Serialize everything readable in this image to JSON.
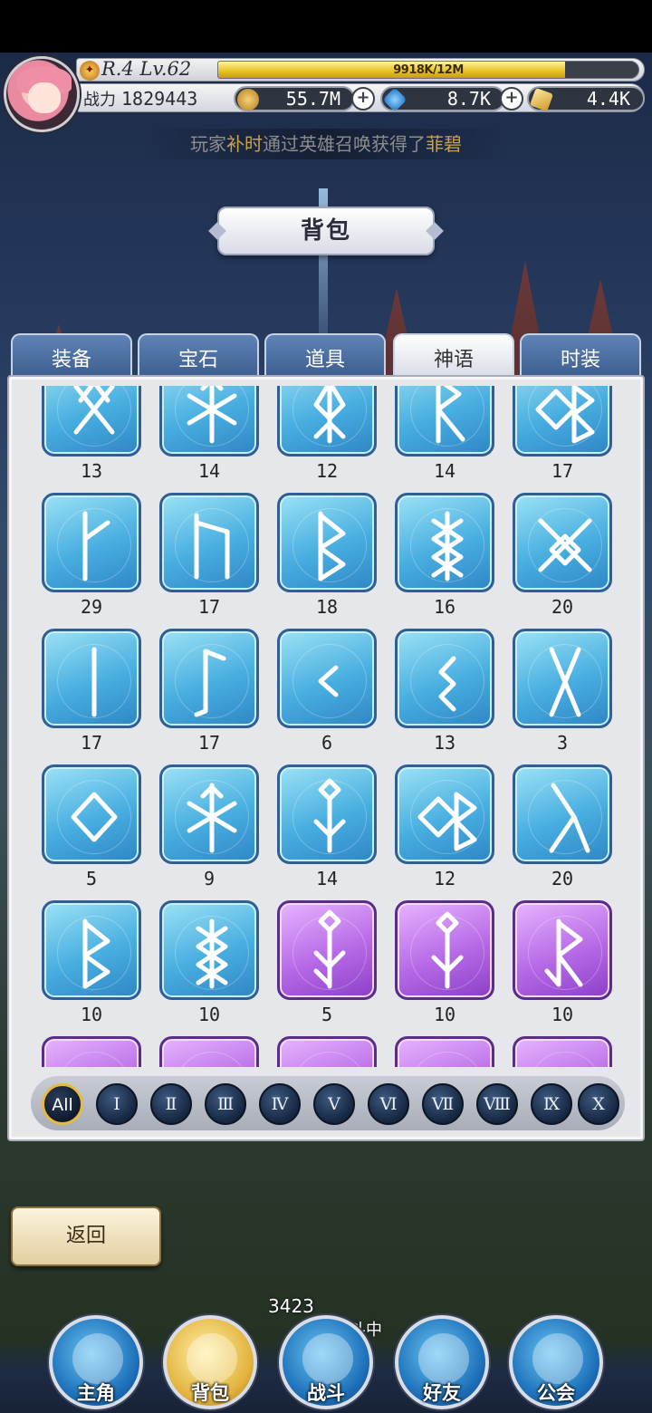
{
  "player": {
    "rank_level": "R.4 Lv.62",
    "exp_text": "9918K/12M",
    "exp_fraction": 0.8265,
    "power_label": "战力",
    "power_value": "1829443"
  },
  "currencies": [
    {
      "name": "gold",
      "icon": "coin-icon",
      "value": "55.7M",
      "color": "#d8a23a"
    },
    {
      "name": "diamond",
      "icon": "diamond-icon",
      "value": "8.7K",
      "color": "#3aa0e6"
    },
    {
      "name": "ticket",
      "icon": "ticket-icon",
      "value": "4.4K",
      "color": "#e8b548"
    }
  ],
  "ticker": {
    "prefix": "玩家",
    "player": "补时",
    "middle": "通过英雄召唤获得了",
    "item": "菲碧"
  },
  "page_title": "背包",
  "tabs": [
    {
      "label": "装备",
      "active": false
    },
    {
      "label": "宝石",
      "active": false
    },
    {
      "label": "道具",
      "active": false
    },
    {
      "label": "神语",
      "active": true
    },
    {
      "label": "时装",
      "active": false
    }
  ],
  "runes": [
    {
      "count": "13",
      "rarity": "blue"
    },
    {
      "count": "14",
      "rarity": "blue"
    },
    {
      "count": "12",
      "rarity": "blue"
    },
    {
      "count": "14",
      "rarity": "blue"
    },
    {
      "count": "17",
      "rarity": "blue"
    },
    {
      "count": "29",
      "rarity": "blue"
    },
    {
      "count": "17",
      "rarity": "blue"
    },
    {
      "count": "18",
      "rarity": "blue"
    },
    {
      "count": "16",
      "rarity": "blue"
    },
    {
      "count": "20",
      "rarity": "blue"
    },
    {
      "count": "17",
      "rarity": "blue"
    },
    {
      "count": "17",
      "rarity": "blue"
    },
    {
      "count": "6",
      "rarity": "blue"
    },
    {
      "count": "13",
      "rarity": "blue"
    },
    {
      "count": "3",
      "rarity": "blue"
    },
    {
      "count": "5",
      "rarity": "blue"
    },
    {
      "count": "9",
      "rarity": "blue"
    },
    {
      "count": "14",
      "rarity": "blue"
    },
    {
      "count": "12",
      "rarity": "blue"
    },
    {
      "count": "20",
      "rarity": "blue"
    },
    {
      "count": "10",
      "rarity": "blue"
    },
    {
      "count": "10",
      "rarity": "blue"
    },
    {
      "count": "5",
      "rarity": "purple"
    },
    {
      "count": "10",
      "rarity": "purple"
    },
    {
      "count": "10",
      "rarity": "purple"
    },
    {
      "count": "",
      "rarity": "purple"
    },
    {
      "count": "",
      "rarity": "purple"
    },
    {
      "count": "",
      "rarity": "purple"
    },
    {
      "count": "",
      "rarity": "purple"
    },
    {
      "count": "",
      "rarity": "purple"
    }
  ],
  "filters": [
    "All",
    "Ⅰ",
    "Ⅱ",
    "Ⅲ",
    "Ⅳ",
    "Ⅴ",
    "Ⅵ",
    "Ⅶ",
    "Ⅷ",
    "Ⅸ",
    "Ⅹ"
  ],
  "active_filter": "All",
  "back_label": "返回",
  "battle_status": {
    "floor": "3423",
    "text": "层战斗中"
  },
  "nav": [
    {
      "label": "主角",
      "icon": "hero-helmet-icon",
      "active": false
    },
    {
      "label": "背包",
      "icon": "backpack-icon",
      "active": true
    },
    {
      "label": "战斗",
      "icon": "crossed-swords-icon",
      "active": false
    },
    {
      "label": "好友",
      "icon": "handshake-icon",
      "active": false
    },
    {
      "label": "公会",
      "icon": "guild-crest-icon",
      "active": false
    }
  ]
}
